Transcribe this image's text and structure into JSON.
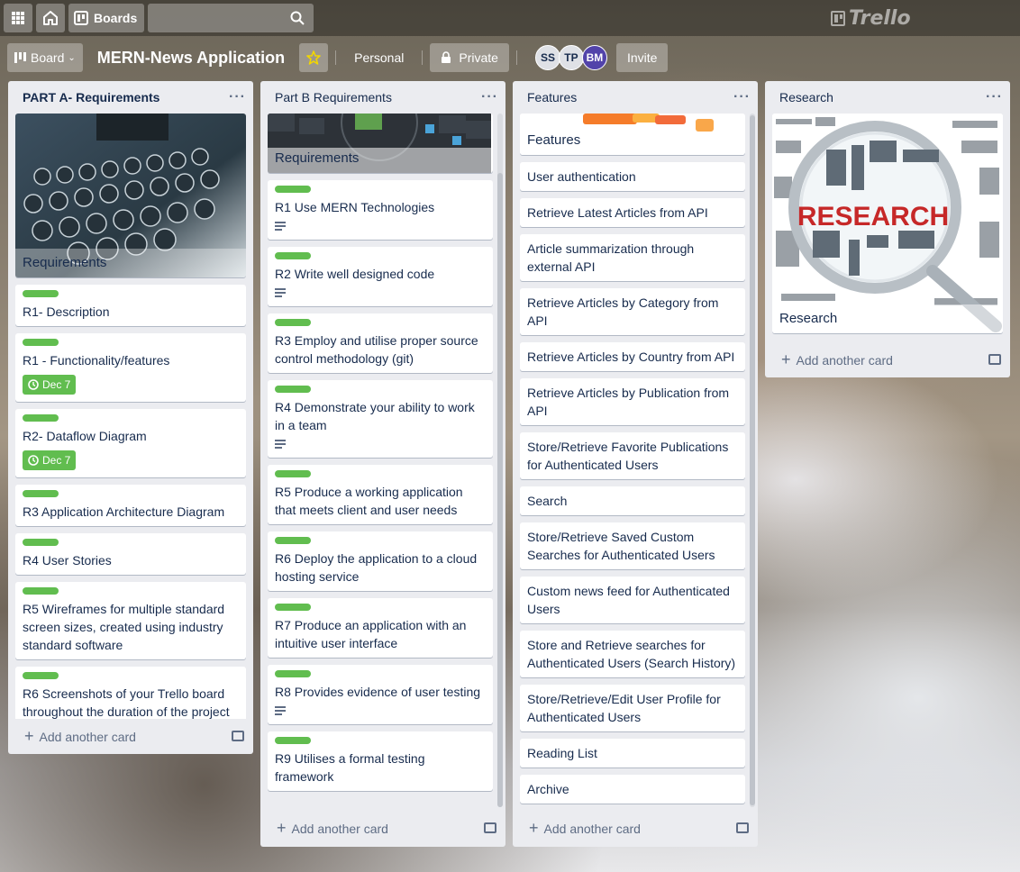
{
  "topbar": {
    "boards_label": "Boards",
    "logo_text": "Trello"
  },
  "boardbar": {
    "view_label": "Board",
    "title": "MERN-News Application",
    "team_label": "Personal",
    "visibility_label": "Private",
    "members": [
      "SS",
      "TP",
      "BM"
    ],
    "invite_label": "Invite"
  },
  "add_card_label": "Add another card",
  "lists": [
    {
      "title": "PART A- Requirements",
      "cover_title": "Requirements",
      "cards": [
        {
          "text": "R1- Description"
        },
        {
          "text": "R1 - Functionality/features",
          "due": "Dec 7"
        },
        {
          "text": "R2- Dataflow Diagram",
          "due": "Dec 7"
        },
        {
          "text": "R3 Application Architecture Diagram"
        },
        {
          "text": "R4 User Stories"
        },
        {
          "text": "R5 Wireframes for multiple standard screen sizes, created using industry standard software"
        },
        {
          "text": "R6 Screenshots of your Trello board throughout the duration of the project"
        }
      ]
    },
    {
      "title": "Part B Requirements",
      "cover_title": "Requirements",
      "cards": [
        {
          "text": "R1 Use MERN Technologies"
        },
        {
          "text": "R2 Write well designed code"
        },
        {
          "text": "R3 Employ and utilise proper source control methodology (git)"
        },
        {
          "text": "R4 Demonstrate your ability to work in a team"
        },
        {
          "text": "R5 Produce a working application that meets client and user needs"
        },
        {
          "text": "R6 Deploy the application to a cloud hosting service"
        },
        {
          "text": "R7 Produce an application with an intuitive user interface"
        },
        {
          "text": "R8 Provides evidence of user testing"
        },
        {
          "text": "R9 Utilises a formal testing framework"
        }
      ]
    },
    {
      "title": "Features",
      "cover_title": "Features",
      "cards": [
        {
          "text": "User authentication"
        },
        {
          "text": "Retrieve Latest Articles from API"
        },
        {
          "text": "Article summarization through external API"
        },
        {
          "text": "Retrieve Articles by Category from API"
        },
        {
          "text": "Retrieve Articles by Country from API"
        },
        {
          "text": "Retrieve Articles by Publication from API"
        },
        {
          "text": "Store/Retrieve Favorite Publications for Authenticated Users"
        },
        {
          "text": "Search"
        },
        {
          "text": "Store/Retrieve Saved Custom Searches for Authenticated Users"
        },
        {
          "text": "Custom news feed for Authenticated Users"
        },
        {
          "text": "Store and Retrieve searches for Authenticated Users (Search History)"
        },
        {
          "text": "Store/Retrieve/Edit User Profile for Authenticated Users"
        },
        {
          "text": "Reading List"
        },
        {
          "text": "Archive"
        }
      ]
    },
    {
      "title": "Research",
      "cover_title": "Research",
      "cover_word": "RESEARCH",
      "cards": []
    }
  ],
  "colors": {
    "label_green": "#61bd4f",
    "list_bg": "#ebecf0",
    "text": "#172b4d"
  }
}
